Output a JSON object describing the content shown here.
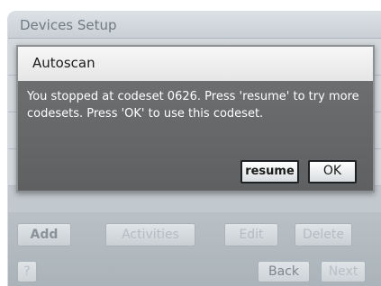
{
  "header": {
    "title": "Devices Setup"
  },
  "dialog": {
    "title": "Autoscan",
    "message": "You stopped at codeset 0626. Press 'resume' to try more codesets. Press 'OK' to use this codeset.",
    "resume_label": "resume",
    "ok_label": "OK"
  },
  "toolbar": {
    "add_label": "Add",
    "activities_label": "Activities",
    "edit_label": "Edit",
    "delete_label": "Delete"
  },
  "footer": {
    "help_label": "?",
    "back_label": "Back",
    "next_label": "Next"
  }
}
